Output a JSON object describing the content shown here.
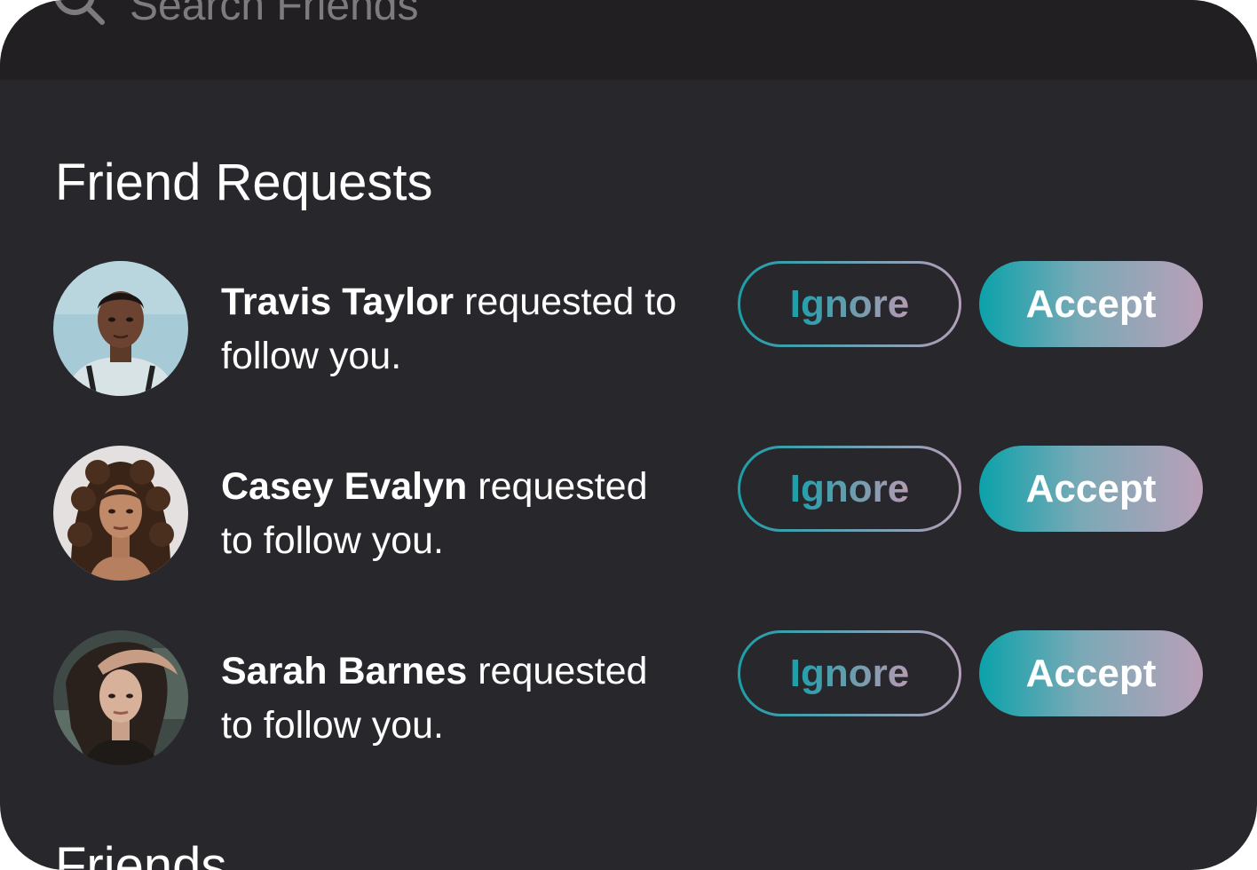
{
  "search": {
    "placeholder": "Search Friends"
  },
  "sections": {
    "requests_title": "Friend Requests",
    "friends_title": "Friends"
  },
  "requests": [
    {
      "name": "Travis Taylor",
      "line1_suffix": " requested to",
      "line2": "follow you.",
      "ignore_label": "Ignore",
      "accept_label": "Accept"
    },
    {
      "name": "Casey Evalyn",
      "line1_suffix": " requested",
      "line2": "to follow you.",
      "ignore_label": "Ignore",
      "accept_label": "Accept"
    },
    {
      "name": "Sarah Barnes",
      "line1_suffix": " requested",
      "line2": "to follow you.",
      "ignore_label": "Ignore",
      "accept_label": "Accept"
    }
  ],
  "colors": {
    "background": "#28272c",
    "search_bar": "#211f21",
    "accent_teal": "#0ba2aa",
    "accent_mauve": "#b9a0b8"
  },
  "icons": {
    "search": "search-icon"
  }
}
